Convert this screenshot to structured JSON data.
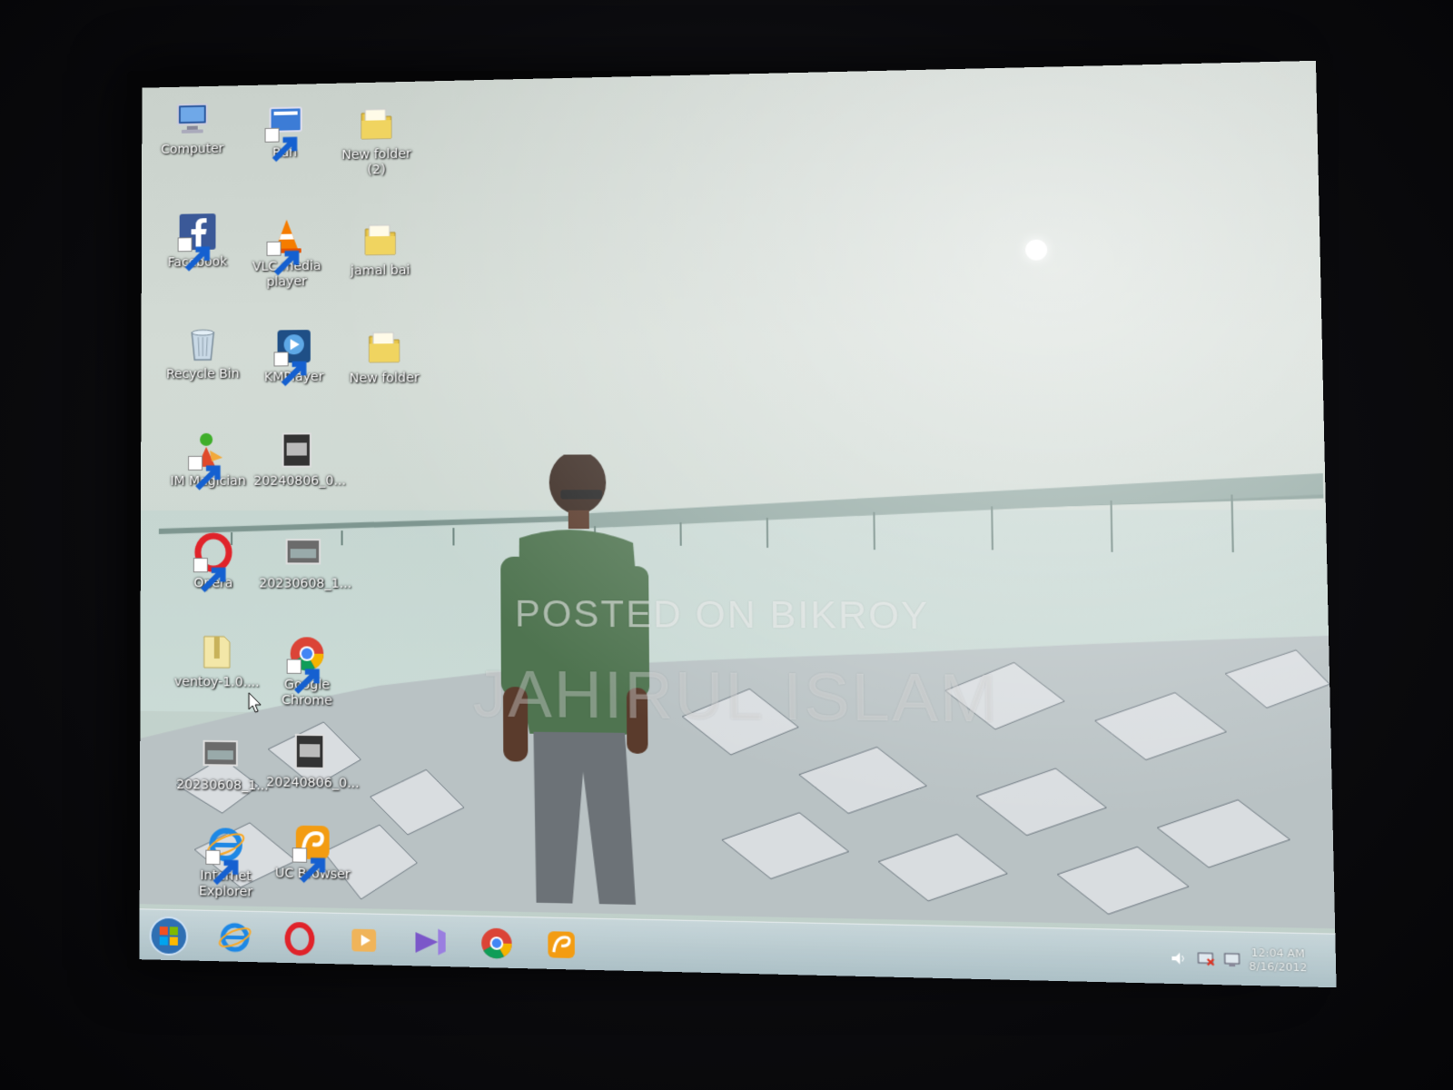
{
  "desktop": {
    "icons": [
      {
        "label": "Computer",
        "kind": "computer-icon"
      },
      {
        "label": "Run",
        "kind": "run-icon"
      },
      {
        "label": "New folder (2)",
        "kind": "folder-icon"
      },
      {
        "label": "Facebook",
        "kind": "facebook-icon"
      },
      {
        "label": "VLC media player",
        "kind": "vlc-icon"
      },
      {
        "label": "jamal bai",
        "kind": "folder-icon"
      },
      {
        "label": "Recycle Bin",
        "kind": "recycle-bin-icon"
      },
      {
        "label": "KMPlayer",
        "kind": "kmplayer-icon"
      },
      {
        "label": "New folder",
        "kind": "folder-icon"
      },
      {
        "label": "IM Magician",
        "kind": "im-magician-icon"
      },
      {
        "label": "20240806_0...",
        "kind": "image-file-icon"
      },
      {
        "label": "Opera",
        "kind": "opera-icon"
      },
      {
        "label": "20230608_1...",
        "kind": "image-file-icon"
      },
      {
        "label": "ventoy-1.0....",
        "kind": "zip-file-icon"
      },
      {
        "label": "Google Chrome",
        "kind": "chrome-icon"
      },
      {
        "label": "20230608_1...",
        "kind": "image-file-icon"
      },
      {
        "label": "20240806_0...",
        "kind": "image-file-icon"
      },
      {
        "label": "Internet Explorer",
        "kind": "internet-explorer-icon"
      },
      {
        "label": "UC Browser",
        "kind": "uc-browser-icon"
      }
    ]
  },
  "wallpaper": {
    "watermark_line1": "POSTED ON BIKROY",
    "watermark_line2": "JAHIRUL ISLAM"
  },
  "taskbar": {
    "start": "windows-start-orb",
    "pinned": [
      "internet-explorer-icon",
      "opera-icon",
      "media-player-icon",
      "visual-studio-icon",
      "chrome-icon",
      "uc-browser-icon"
    ],
    "tray": [
      "volume-icon",
      "network-icon",
      "action-center-icon"
    ],
    "clock_time": "12:04 AM",
    "clock_date": "8/16/2012"
  },
  "colors": {
    "taskbar": "#aabec6",
    "sky": "#d3dbd5"
  }
}
